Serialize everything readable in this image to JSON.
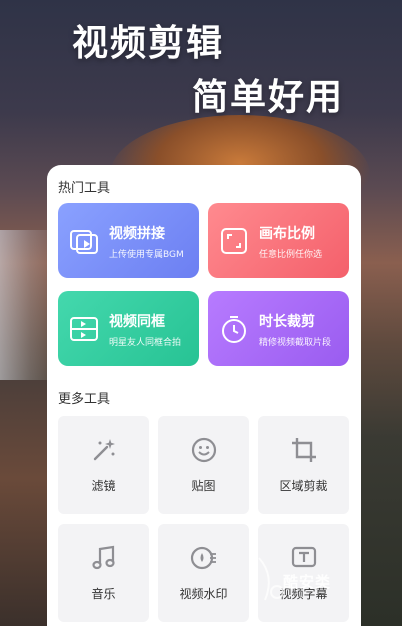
{
  "header": {
    "line1": "视频剪辑",
    "line2": "简单好用"
  },
  "hot_tools": {
    "title": "热门工具",
    "items": [
      {
        "title": "视频拼接",
        "subtitle": "上传使用专属BGM",
        "icon": "video-splice-icon",
        "color": "#7a8df8"
      },
      {
        "title": "画布比例",
        "subtitle": "任意比例任你选",
        "icon": "canvas-ratio-icon",
        "color": "#f7707a"
      },
      {
        "title": "视频同框",
        "subtitle": "明星友人同框合拍",
        "icon": "video-sameframe-icon",
        "color": "#33cfa1"
      },
      {
        "title": "时长裁剪",
        "subtitle": "精修视频截取片段",
        "icon": "timer-icon",
        "color": "#a96cf8"
      }
    ]
  },
  "more_tools": {
    "title": "更多工具",
    "items": [
      {
        "label": "滤镜",
        "icon": "magic-wand-icon"
      },
      {
        "label": "贴图",
        "icon": "sticker-smile-icon"
      },
      {
        "label": "区域剪裁",
        "icon": "crop-icon"
      },
      {
        "label": "音乐",
        "icon": "music-note-icon"
      },
      {
        "label": "视频水印",
        "icon": "watermark-icon"
      },
      {
        "label": "视频字幕",
        "icon": "subtitle-icon"
      }
    ]
  },
  "watermark": {
    "text": "酷安类",
    "icon": "watermark-logo-icon"
  },
  "colors": {
    "panel_bg": "#ffffff",
    "tile_bg": "#f3f3f5",
    "icon_gray": "#8e8e93"
  }
}
